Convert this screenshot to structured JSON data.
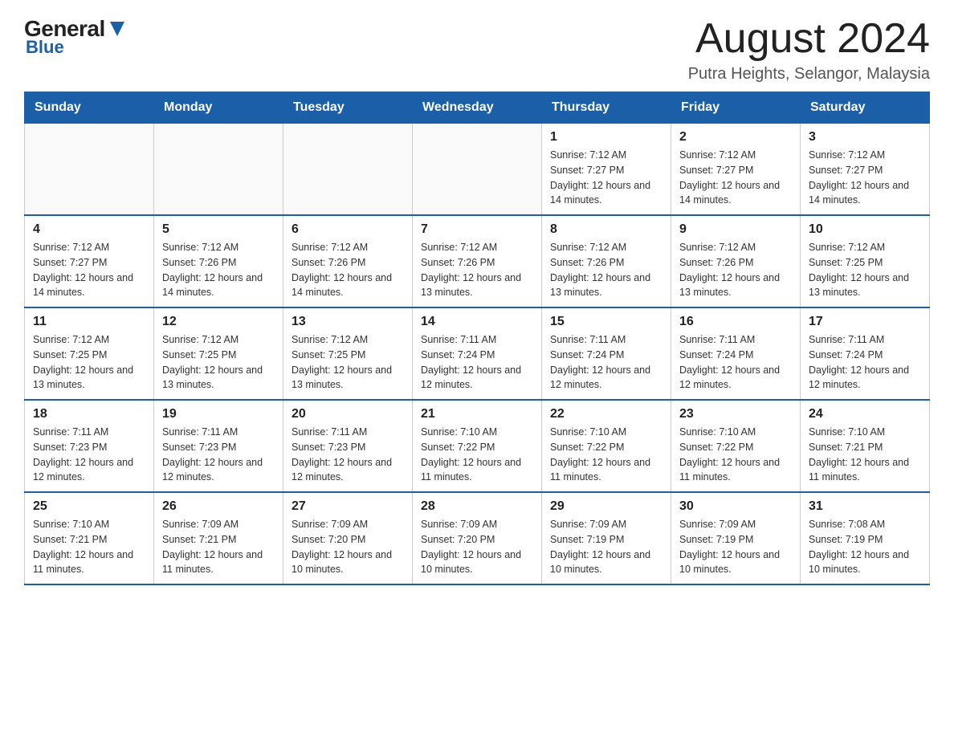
{
  "header": {
    "logo": {
      "general": "General",
      "blue": "Blue",
      "icon": "triangle"
    },
    "title": "August 2024",
    "location": "Putra Heights, Selangor, Malaysia"
  },
  "calendar": {
    "days_of_week": [
      "Sunday",
      "Monday",
      "Tuesday",
      "Wednesday",
      "Thursday",
      "Friday",
      "Saturday"
    ],
    "weeks": [
      {
        "days": [
          {
            "date": "",
            "empty": true
          },
          {
            "date": "",
            "empty": true
          },
          {
            "date": "",
            "empty": true
          },
          {
            "date": "",
            "empty": true
          },
          {
            "date": "1",
            "sunrise": "7:12 AM",
            "sunset": "7:27 PM",
            "daylight": "12 hours and 14 minutes."
          },
          {
            "date": "2",
            "sunrise": "7:12 AM",
            "sunset": "7:27 PM",
            "daylight": "12 hours and 14 minutes."
          },
          {
            "date": "3",
            "sunrise": "7:12 AM",
            "sunset": "7:27 PM",
            "daylight": "12 hours and 14 minutes."
          }
        ]
      },
      {
        "days": [
          {
            "date": "4",
            "sunrise": "7:12 AM",
            "sunset": "7:27 PM",
            "daylight": "12 hours and 14 minutes."
          },
          {
            "date": "5",
            "sunrise": "7:12 AM",
            "sunset": "7:26 PM",
            "daylight": "12 hours and 14 minutes."
          },
          {
            "date": "6",
            "sunrise": "7:12 AM",
            "sunset": "7:26 PM",
            "daylight": "12 hours and 14 minutes."
          },
          {
            "date": "7",
            "sunrise": "7:12 AM",
            "sunset": "7:26 PM",
            "daylight": "12 hours and 13 minutes."
          },
          {
            "date": "8",
            "sunrise": "7:12 AM",
            "sunset": "7:26 PM",
            "daylight": "12 hours and 13 minutes."
          },
          {
            "date": "9",
            "sunrise": "7:12 AM",
            "sunset": "7:26 PM",
            "daylight": "12 hours and 13 minutes."
          },
          {
            "date": "10",
            "sunrise": "7:12 AM",
            "sunset": "7:25 PM",
            "daylight": "12 hours and 13 minutes."
          }
        ]
      },
      {
        "days": [
          {
            "date": "11",
            "sunrise": "7:12 AM",
            "sunset": "7:25 PM",
            "daylight": "12 hours and 13 minutes."
          },
          {
            "date": "12",
            "sunrise": "7:12 AM",
            "sunset": "7:25 PM",
            "daylight": "12 hours and 13 minutes."
          },
          {
            "date": "13",
            "sunrise": "7:12 AM",
            "sunset": "7:25 PM",
            "daylight": "12 hours and 13 minutes."
          },
          {
            "date": "14",
            "sunrise": "7:11 AM",
            "sunset": "7:24 PM",
            "daylight": "12 hours and 12 minutes."
          },
          {
            "date": "15",
            "sunrise": "7:11 AM",
            "sunset": "7:24 PM",
            "daylight": "12 hours and 12 minutes."
          },
          {
            "date": "16",
            "sunrise": "7:11 AM",
            "sunset": "7:24 PM",
            "daylight": "12 hours and 12 minutes."
          },
          {
            "date": "17",
            "sunrise": "7:11 AM",
            "sunset": "7:24 PM",
            "daylight": "12 hours and 12 minutes."
          }
        ]
      },
      {
        "days": [
          {
            "date": "18",
            "sunrise": "7:11 AM",
            "sunset": "7:23 PM",
            "daylight": "12 hours and 12 minutes."
          },
          {
            "date": "19",
            "sunrise": "7:11 AM",
            "sunset": "7:23 PM",
            "daylight": "12 hours and 12 minutes."
          },
          {
            "date": "20",
            "sunrise": "7:11 AM",
            "sunset": "7:23 PM",
            "daylight": "12 hours and 12 minutes."
          },
          {
            "date": "21",
            "sunrise": "7:10 AM",
            "sunset": "7:22 PM",
            "daylight": "12 hours and 11 minutes."
          },
          {
            "date": "22",
            "sunrise": "7:10 AM",
            "sunset": "7:22 PM",
            "daylight": "12 hours and 11 minutes."
          },
          {
            "date": "23",
            "sunrise": "7:10 AM",
            "sunset": "7:22 PM",
            "daylight": "12 hours and 11 minutes."
          },
          {
            "date": "24",
            "sunrise": "7:10 AM",
            "sunset": "7:21 PM",
            "daylight": "12 hours and 11 minutes."
          }
        ]
      },
      {
        "days": [
          {
            "date": "25",
            "sunrise": "7:10 AM",
            "sunset": "7:21 PM",
            "daylight": "12 hours and 11 minutes."
          },
          {
            "date": "26",
            "sunrise": "7:09 AM",
            "sunset": "7:21 PM",
            "daylight": "12 hours and 11 minutes."
          },
          {
            "date": "27",
            "sunrise": "7:09 AM",
            "sunset": "7:20 PM",
            "daylight": "12 hours and 10 minutes."
          },
          {
            "date": "28",
            "sunrise": "7:09 AM",
            "sunset": "7:20 PM",
            "daylight": "12 hours and 10 minutes."
          },
          {
            "date": "29",
            "sunrise": "7:09 AM",
            "sunset": "7:19 PM",
            "daylight": "12 hours and 10 minutes."
          },
          {
            "date": "30",
            "sunrise": "7:09 AM",
            "sunset": "7:19 PM",
            "daylight": "12 hours and 10 minutes."
          },
          {
            "date": "31",
            "sunrise": "7:08 AM",
            "sunset": "7:19 PM",
            "daylight": "12 hours and 10 minutes."
          }
        ]
      }
    ]
  }
}
